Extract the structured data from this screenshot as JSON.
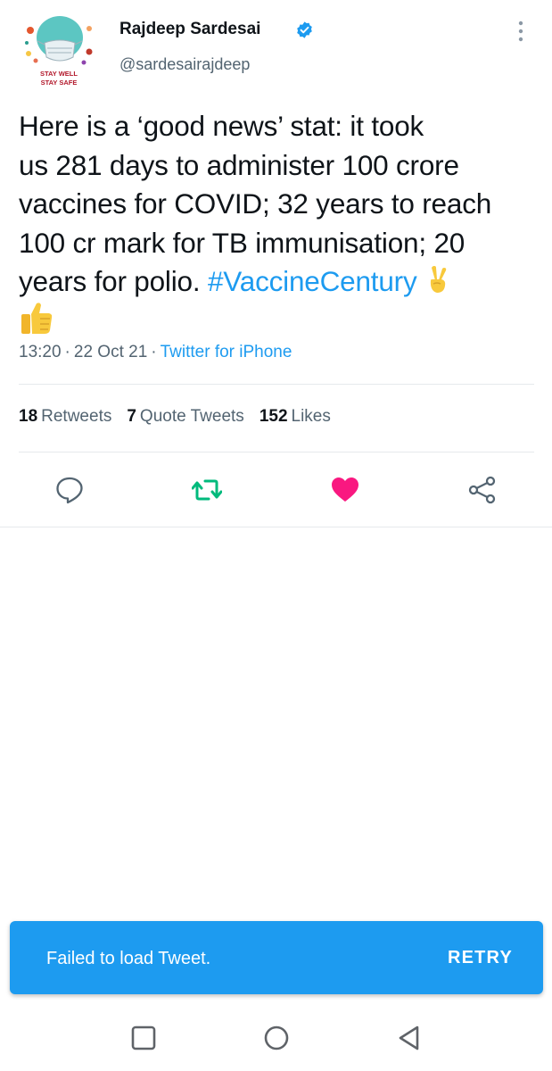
{
  "profile": {
    "avatar_caption_line1": "STAY WELL",
    "avatar_caption_line2": "STAY SAFE",
    "display_name": "Rajdeep Sardesai",
    "handle": "@sardesairajdeep",
    "verified": true
  },
  "tweet": {
    "lines": [
      "Here is a ‘good news’ stat: it took",
      "us 281 days to administer 100 crore",
      "vaccines for COVID; 32 years to reach",
      "100 cr mark for TB immunisation; 20",
      "years for polio. "
    ],
    "hashtag": "#VaccineCentury",
    "emojis": [
      "victory-hand-emoji",
      "thumbs-up-emoji"
    ]
  },
  "meta": {
    "time": "13:20",
    "date": "22 Oct 21",
    "separator": "·",
    "source": "Twitter for iPhone"
  },
  "stats": {
    "retweets_count": "18",
    "retweets_label": "Retweets",
    "quotes_count": "7",
    "quotes_label": "Quote Tweets",
    "likes_count": "152",
    "likes_label": "Likes"
  },
  "actions": {
    "icons": [
      "reply-icon",
      "retweet-icon",
      "like-icon",
      "share-icon"
    ],
    "liked": true,
    "retweet_color": "#00ba7c",
    "like_color": "#f91880"
  },
  "toast": {
    "message": "Failed to load Tweet.",
    "action": "RETRY",
    "background": "#1d9bf0"
  },
  "navbar": {
    "icons": [
      "recents-square-icon",
      "home-circle-icon",
      "back-triangle-icon"
    ]
  },
  "colors": {
    "text_primary": "#0f1419",
    "text_secondary": "#536471",
    "accent": "#1d9bf0"
  }
}
